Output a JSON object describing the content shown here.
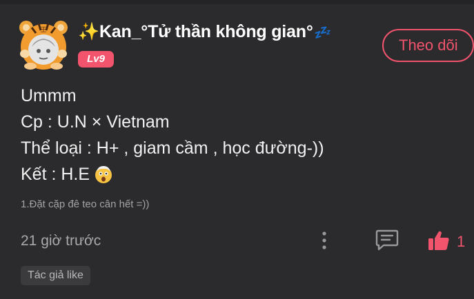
{
  "post": {
    "author": {
      "sparkle": "✨",
      "name": "Kan_°Tử thần không gian°",
      "zzz": "💤",
      "level": "Lv9",
      "avatar_icon": "tiger-hat-avatar-icon"
    },
    "follow_label": "Theo dõi",
    "lines": [
      "Ummm",
      "Cp : U.N × Vietnam",
      "Thể loại : H+ , giam cầm , học đường-))",
      "Kết : H.E"
    ],
    "last_line_emoji": "shocked-face-icon",
    "sub_note": "1.Đặt cặp đê teo cân hết =))",
    "time_ago": "21 giờ trước",
    "like_count": "1",
    "tag": "Tác giả like"
  },
  "colors": {
    "background": "#2b2b2d",
    "accent": "#f2536d",
    "muted": "#a9a9ac"
  }
}
